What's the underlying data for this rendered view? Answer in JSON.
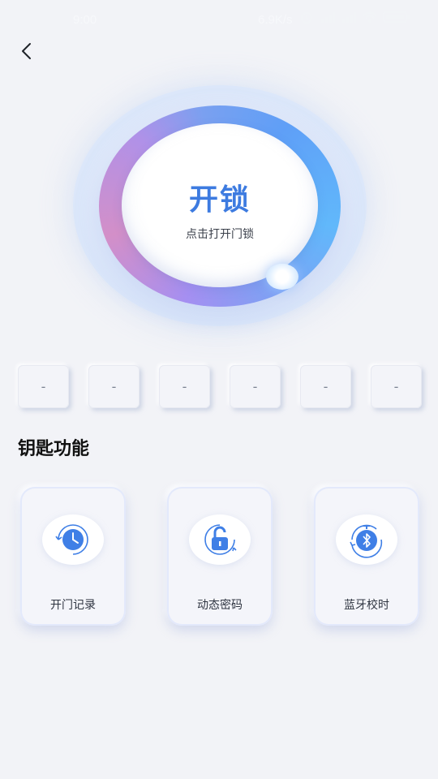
{
  "status_bar": {
    "time": "9:00",
    "net_speed": "6.9K/s",
    "icons": [
      "alarm-icon",
      "signal-icon",
      "signal-icon",
      "wifi-icon",
      "battery-icon"
    ]
  },
  "header": {
    "back_icon": "chevron-left-icon"
  },
  "lock": {
    "title": "开锁",
    "subtitle": "点击打开门锁"
  },
  "codes": [
    "-",
    "-",
    "-",
    "-",
    "-",
    "-"
  ],
  "section": {
    "title": "钥匙功能"
  },
  "features": [
    {
      "label": "开门记录",
      "icon": "clock-history-icon"
    },
    {
      "label": "动态密码",
      "icon": "unlock-refresh-icon"
    },
    {
      "label": "蓝牙校时",
      "icon": "bluetooth-timer-icon"
    }
  ],
  "colors": {
    "accent": "#3d7be0",
    "icon_blue": "#3f7fe6",
    "background": "#f2f3f7"
  }
}
